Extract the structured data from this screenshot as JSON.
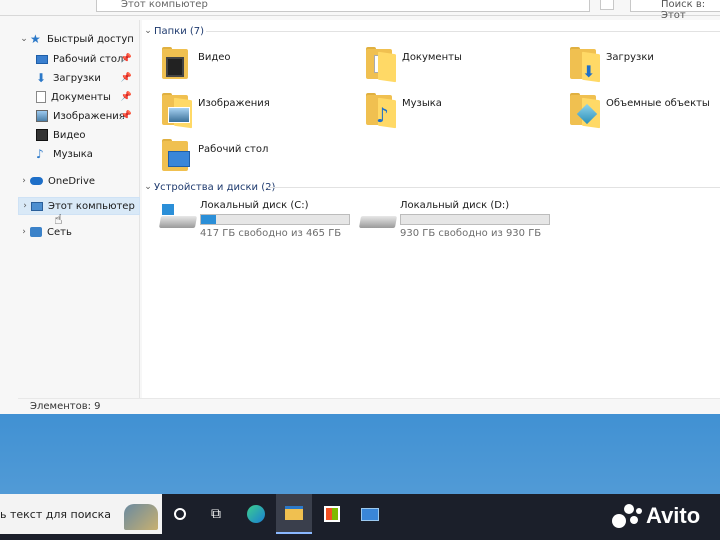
{
  "address_bar": {
    "path": "Этот компьютер",
    "search_placeholder": "Поиск в: Этот"
  },
  "nav_pane": {
    "quick_access": "Быстрый доступ",
    "quick_items": [
      {
        "label": "Рабочий стол",
        "icon": "desktop-icon"
      },
      {
        "label": "Загрузки",
        "icon": "download-icon"
      },
      {
        "label": "Документы",
        "icon": "document-icon"
      },
      {
        "label": "Изображения",
        "icon": "pictures-icon"
      },
      {
        "label": "Видео",
        "icon": "video-icon"
      },
      {
        "label": "Музыка",
        "icon": "music-icon"
      }
    ],
    "onedrive": "OneDrive",
    "this_pc": "Этот компьютер",
    "network": "Сеть"
  },
  "folders_group": {
    "header": "Папки (7)",
    "items": [
      {
        "label": "Видео",
        "icon": "video-folder-icon"
      },
      {
        "label": "Документы",
        "icon": "documents-folder-icon"
      },
      {
        "label": "Загрузки",
        "icon": "downloads-folder-icon"
      },
      {
        "label": "Изображения",
        "icon": "pictures-folder-icon"
      },
      {
        "label": "Музыка",
        "icon": "music-folder-icon"
      },
      {
        "label": "Объемные объекты",
        "icon": "3d-objects-folder-icon"
      },
      {
        "label": "Рабочий стол",
        "icon": "desktop-folder-icon"
      }
    ]
  },
  "drives_group": {
    "header": "Устройства и диски (2)",
    "items": [
      {
        "name": "Локальный диск (C:)",
        "free_text": "417 ГБ свободно из 465 ГБ",
        "used_fraction": 0.103
      },
      {
        "name": "Локальный диск (D:)",
        "free_text": "930 ГБ свободно из 930 ГБ",
        "used_fraction": 0.0
      }
    ]
  },
  "status_bar": {
    "count": "Элементов: 9"
  },
  "taskbar": {
    "search_text": "ь текст для поиска"
  },
  "watermark": {
    "text": "Avito"
  },
  "colors": {
    "accent": "#2b8fd8",
    "selection": "#d9e9f7",
    "folder": "#f0c050"
  }
}
